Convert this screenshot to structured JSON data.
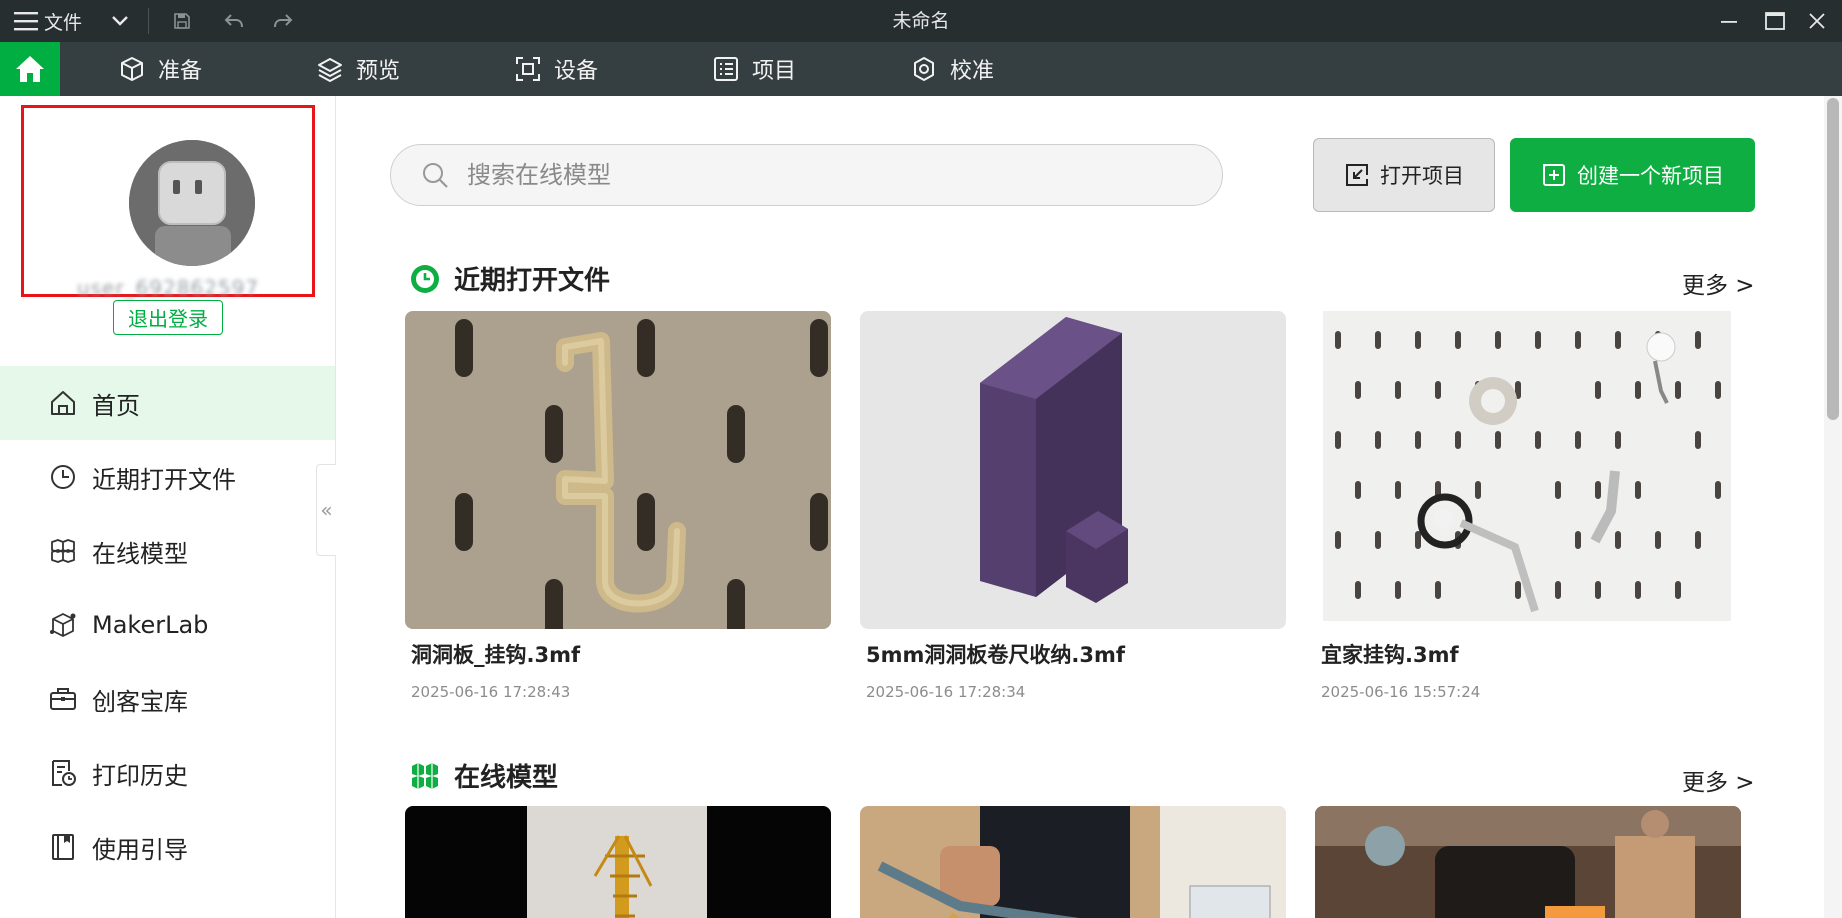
{
  "titlebar": {
    "file_menu_label": "文件",
    "window_title": "未命名"
  },
  "nav": {
    "tabs": [
      {
        "label": "准备"
      },
      {
        "label": "预览"
      },
      {
        "label": "设备"
      },
      {
        "label": "项目"
      },
      {
        "label": "校准"
      }
    ]
  },
  "sidebar": {
    "username": "user_692862597",
    "logout_label": "退出登录",
    "items": [
      {
        "label": "首页"
      },
      {
        "label": "近期打开文件"
      },
      {
        "label": "在线模型"
      },
      {
        "label": "MakerLab"
      },
      {
        "label": "创客宝库"
      },
      {
        "label": "打印历史"
      },
      {
        "label": "使用引导"
      }
    ],
    "collapse_glyph": "«"
  },
  "main": {
    "search_placeholder": "搜索在线模型",
    "open_project_label": "打开项目",
    "new_project_label": "创建一个新项目",
    "recent": {
      "title": "近期打开文件",
      "more_label": "更多 >",
      "files": [
        {
          "name": "洞洞板_挂钩.3mf",
          "date": "2025-06-16 17:28:43"
        },
        {
          "name": "5mm洞洞板卷尺收纳.3mf",
          "date": "2025-06-16 17:28:34"
        },
        {
          "name": "宜家挂钩.3mf",
          "date": "2025-06-16 15:57:24"
        }
      ]
    },
    "online": {
      "title": "在线模型",
      "more_label": "更多 >"
    }
  },
  "colors": {
    "accent": "#00ae42",
    "titlebar_bg": "#262e30",
    "navbar_bg": "#353e40",
    "highlight_border": "#e8141a",
    "active_item_bg": "#e5f8ea"
  }
}
